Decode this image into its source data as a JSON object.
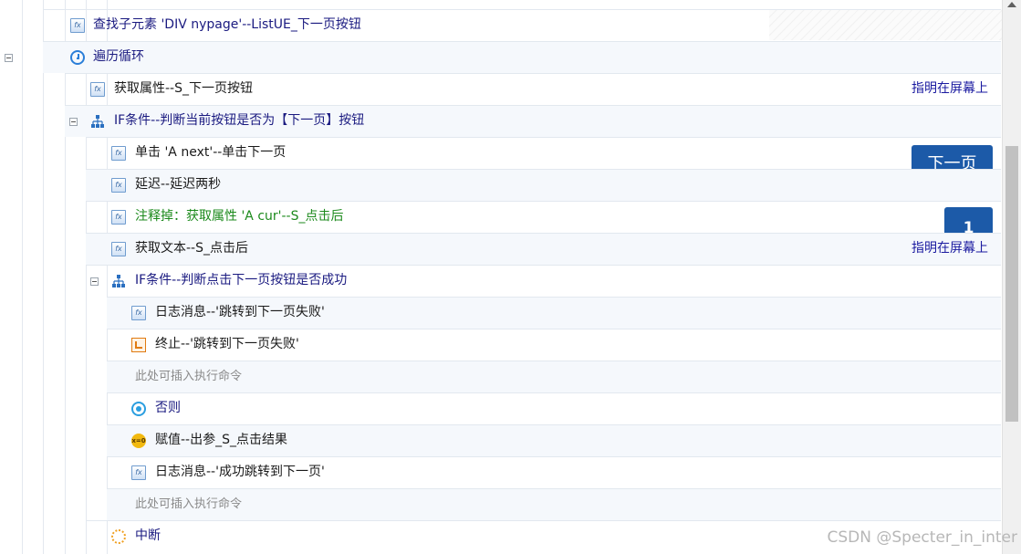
{
  "rows": [
    {
      "label": "查找子元素 'DIV nypage'--ListUE_下一页按钮",
      "icon": "fx-icon",
      "note": ""
    },
    {
      "label": "遍历循环",
      "icon": "loop-icon",
      "note": ""
    },
    {
      "label": "获取属性--S_下一页按钮",
      "icon": "fx-icon",
      "note": "指明在屏幕上"
    },
    {
      "label": "IF条件--判断当前按钮是否为【下一页】按钮",
      "icon": "condition-tree-icon",
      "note": ""
    },
    {
      "label": "单击 'A next'--单击下一页",
      "icon": "fx-icon",
      "note": ""
    },
    {
      "label": "延迟--延迟两秒",
      "icon": "fx-icon",
      "note": ""
    },
    {
      "label": "注释掉：获取属性 'A cur'--S_点击后",
      "icon": "fx-icon",
      "note": ""
    },
    {
      "label": "获取文本--S_点击后",
      "icon": "fx-icon",
      "note": "指明在屏幕上"
    },
    {
      "label": "IF条件--判断点击下一页按钮是否成功",
      "icon": "condition-tree-icon",
      "note": ""
    },
    {
      "label": "日志消息--'跳转到下一页失败'",
      "icon": "fx-icon",
      "note": ""
    },
    {
      "label": "终止--'跳转到下一页失败'",
      "icon": "stop-icon",
      "note": ""
    },
    {
      "label": "此处可插入执行命令",
      "icon": "",
      "note": ""
    },
    {
      "label": "否则",
      "icon": "else-icon",
      "note": ""
    },
    {
      "label": "赋值--出参_S_点击结果",
      "icon": "assign-icon",
      "note": ""
    },
    {
      "label": "日志消息--'成功跳转到下一页'",
      "icon": "fx-icon",
      "note": ""
    },
    {
      "label": "此处可插入执行命令",
      "icon": "",
      "note": ""
    },
    {
      "label": "中断",
      "icon": "break-icon",
      "note": ""
    }
  ],
  "overlay": {
    "next_page_button": "下一页",
    "page_number": "1"
  },
  "watermark": "CSDN @Specter_in_inter"
}
